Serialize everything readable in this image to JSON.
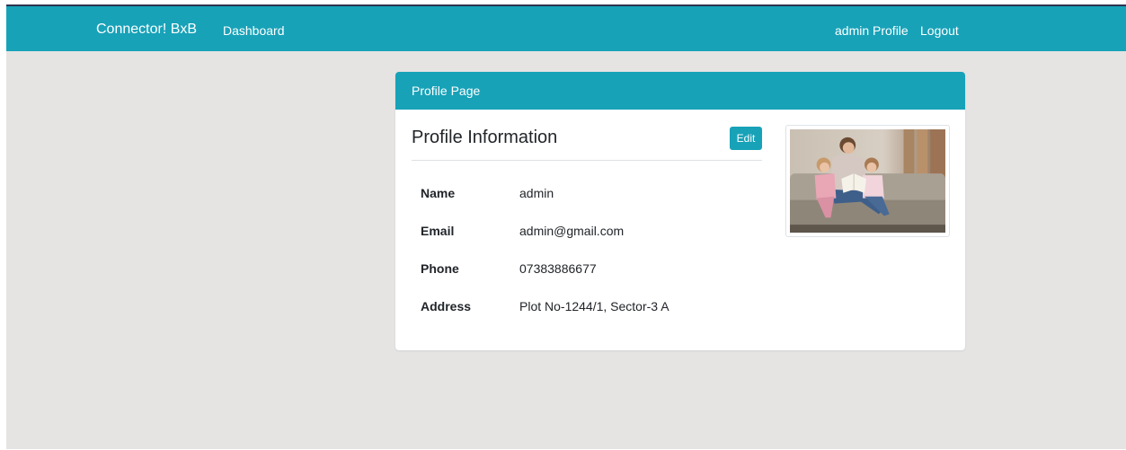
{
  "navbar": {
    "brand": "Connector! BxB",
    "dashboard": "Dashboard",
    "profile": "admin Profile",
    "logout": "Logout",
    "color": "#17a2b8"
  },
  "card": {
    "header": "Profile Page",
    "title": "Profile Information",
    "edit_label": "Edit",
    "photo_icon": "family-reading-photo"
  },
  "profile": {
    "rows": [
      {
        "label": "Name",
        "value": "admin"
      },
      {
        "label": "Email",
        "value": "admin@gmail.com"
      },
      {
        "label": "Phone",
        "value": "07383886677"
      },
      {
        "label": "Address",
        "value": "Plot No-1244/1, Sector-3 A"
      }
    ]
  }
}
